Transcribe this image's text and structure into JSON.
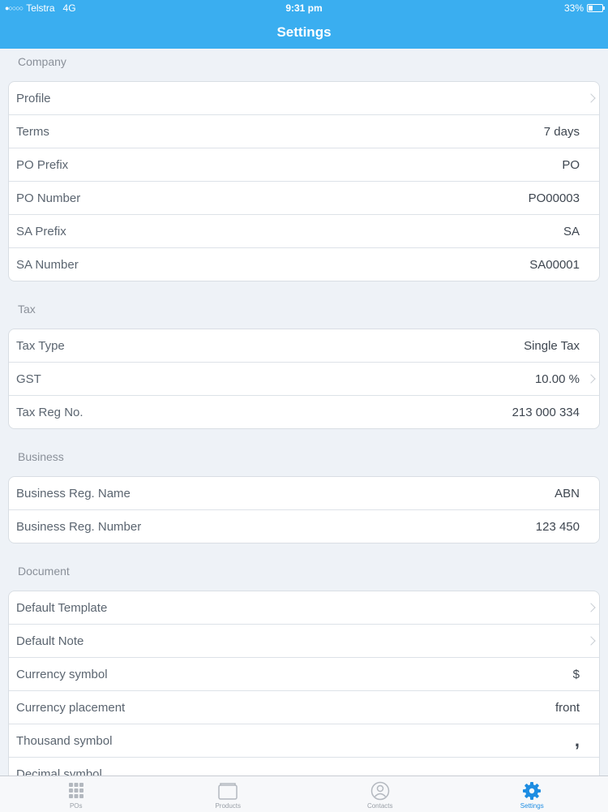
{
  "status": {
    "carrier": "Telstra",
    "network": "4G",
    "time": "9:31 pm",
    "battery": "33%",
    "battery_level": 0.33
  },
  "nav": {
    "title": "Settings"
  },
  "sections": {
    "company": {
      "label": "Company",
      "rows": {
        "profile": {
          "label": "Profile"
        },
        "terms": {
          "label": "Terms",
          "value": "7 days"
        },
        "po_prefix": {
          "label": "PO Prefix",
          "value": "PO"
        },
        "po_number": {
          "label": "PO Number",
          "value": "PO00003"
        },
        "sa_prefix": {
          "label": "SA Prefix",
          "value": "SA"
        },
        "sa_number": {
          "label": "SA Number",
          "value": "SA00001"
        }
      }
    },
    "tax": {
      "label": "Tax",
      "rows": {
        "tax_type": {
          "label": "Tax Type",
          "value": "Single Tax"
        },
        "gst": {
          "label": "GST",
          "value": "10.00 %"
        },
        "tax_reg": {
          "label": "Tax Reg No.",
          "value": "213 000 334"
        }
      }
    },
    "business": {
      "label": "Business",
      "rows": {
        "reg_name": {
          "label": "Business Reg. Name",
          "value": "ABN"
        },
        "reg_number": {
          "label": "Business Reg. Number",
          "value": "123 450"
        }
      }
    },
    "document": {
      "label": "Document",
      "rows": {
        "default_template": {
          "label": "Default Template"
        },
        "default_note": {
          "label": "Default Note"
        },
        "currency_symbol": {
          "label": "Currency symbol",
          "value": "$"
        },
        "currency_placement": {
          "label": "Currency placement",
          "value": "front"
        },
        "thousand_symbol": {
          "label": "Thousand symbol",
          "value": ","
        },
        "decimal_symbol": {
          "label": "Decimal symbol",
          "value": ""
        }
      }
    }
  },
  "tabs": {
    "pos": {
      "label": "POs",
      "icon": "grid-icon"
    },
    "products": {
      "label": "Products",
      "icon": "folder-icon"
    },
    "contacts": {
      "label": "Contacts",
      "icon": "person-icon"
    },
    "settings": {
      "label": "Settings",
      "icon": "gear-icon"
    }
  },
  "colors": {
    "header": "#3aaef0",
    "active_tab": "#1e8de2",
    "inactive_tab": "#9aa0a8"
  }
}
